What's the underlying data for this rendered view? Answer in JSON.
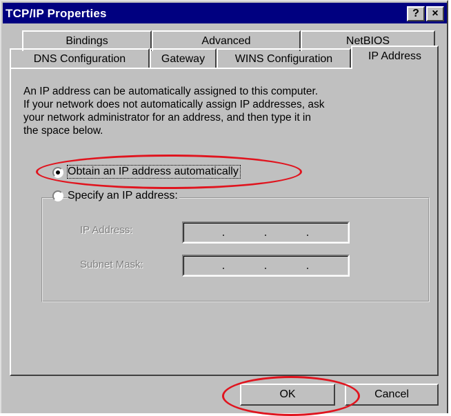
{
  "window": {
    "title": "TCP/IP Properties",
    "help_label": "?",
    "close_label": "×"
  },
  "tabs": {
    "row1": [
      {
        "label": "Bindings"
      },
      {
        "label": "Advanced"
      },
      {
        "label": "NetBIOS"
      }
    ],
    "row2": [
      {
        "label": "DNS Configuration"
      },
      {
        "label": "Gateway"
      },
      {
        "label": "WINS Configuration"
      },
      {
        "label": "IP Address"
      }
    ],
    "active": "IP Address"
  },
  "ip_page": {
    "description": [
      "An IP address can be automatically assigned to this computer.",
      "If your network does not automatically assign IP addresses, ask",
      "your network administrator for an address, and then type it in",
      "the space below."
    ],
    "obtain_auto": {
      "label": "Obtain an IP address automatically",
      "selected": true
    },
    "specify": {
      "label": "Specify an IP address:",
      "selected": false
    },
    "ip_address_label": "IP Address:",
    "subnet_mask_label": "Subnet Mask:"
  },
  "buttons": {
    "ok": "OK",
    "cancel": "Cancel"
  },
  "annotation_color": "#e0141e"
}
